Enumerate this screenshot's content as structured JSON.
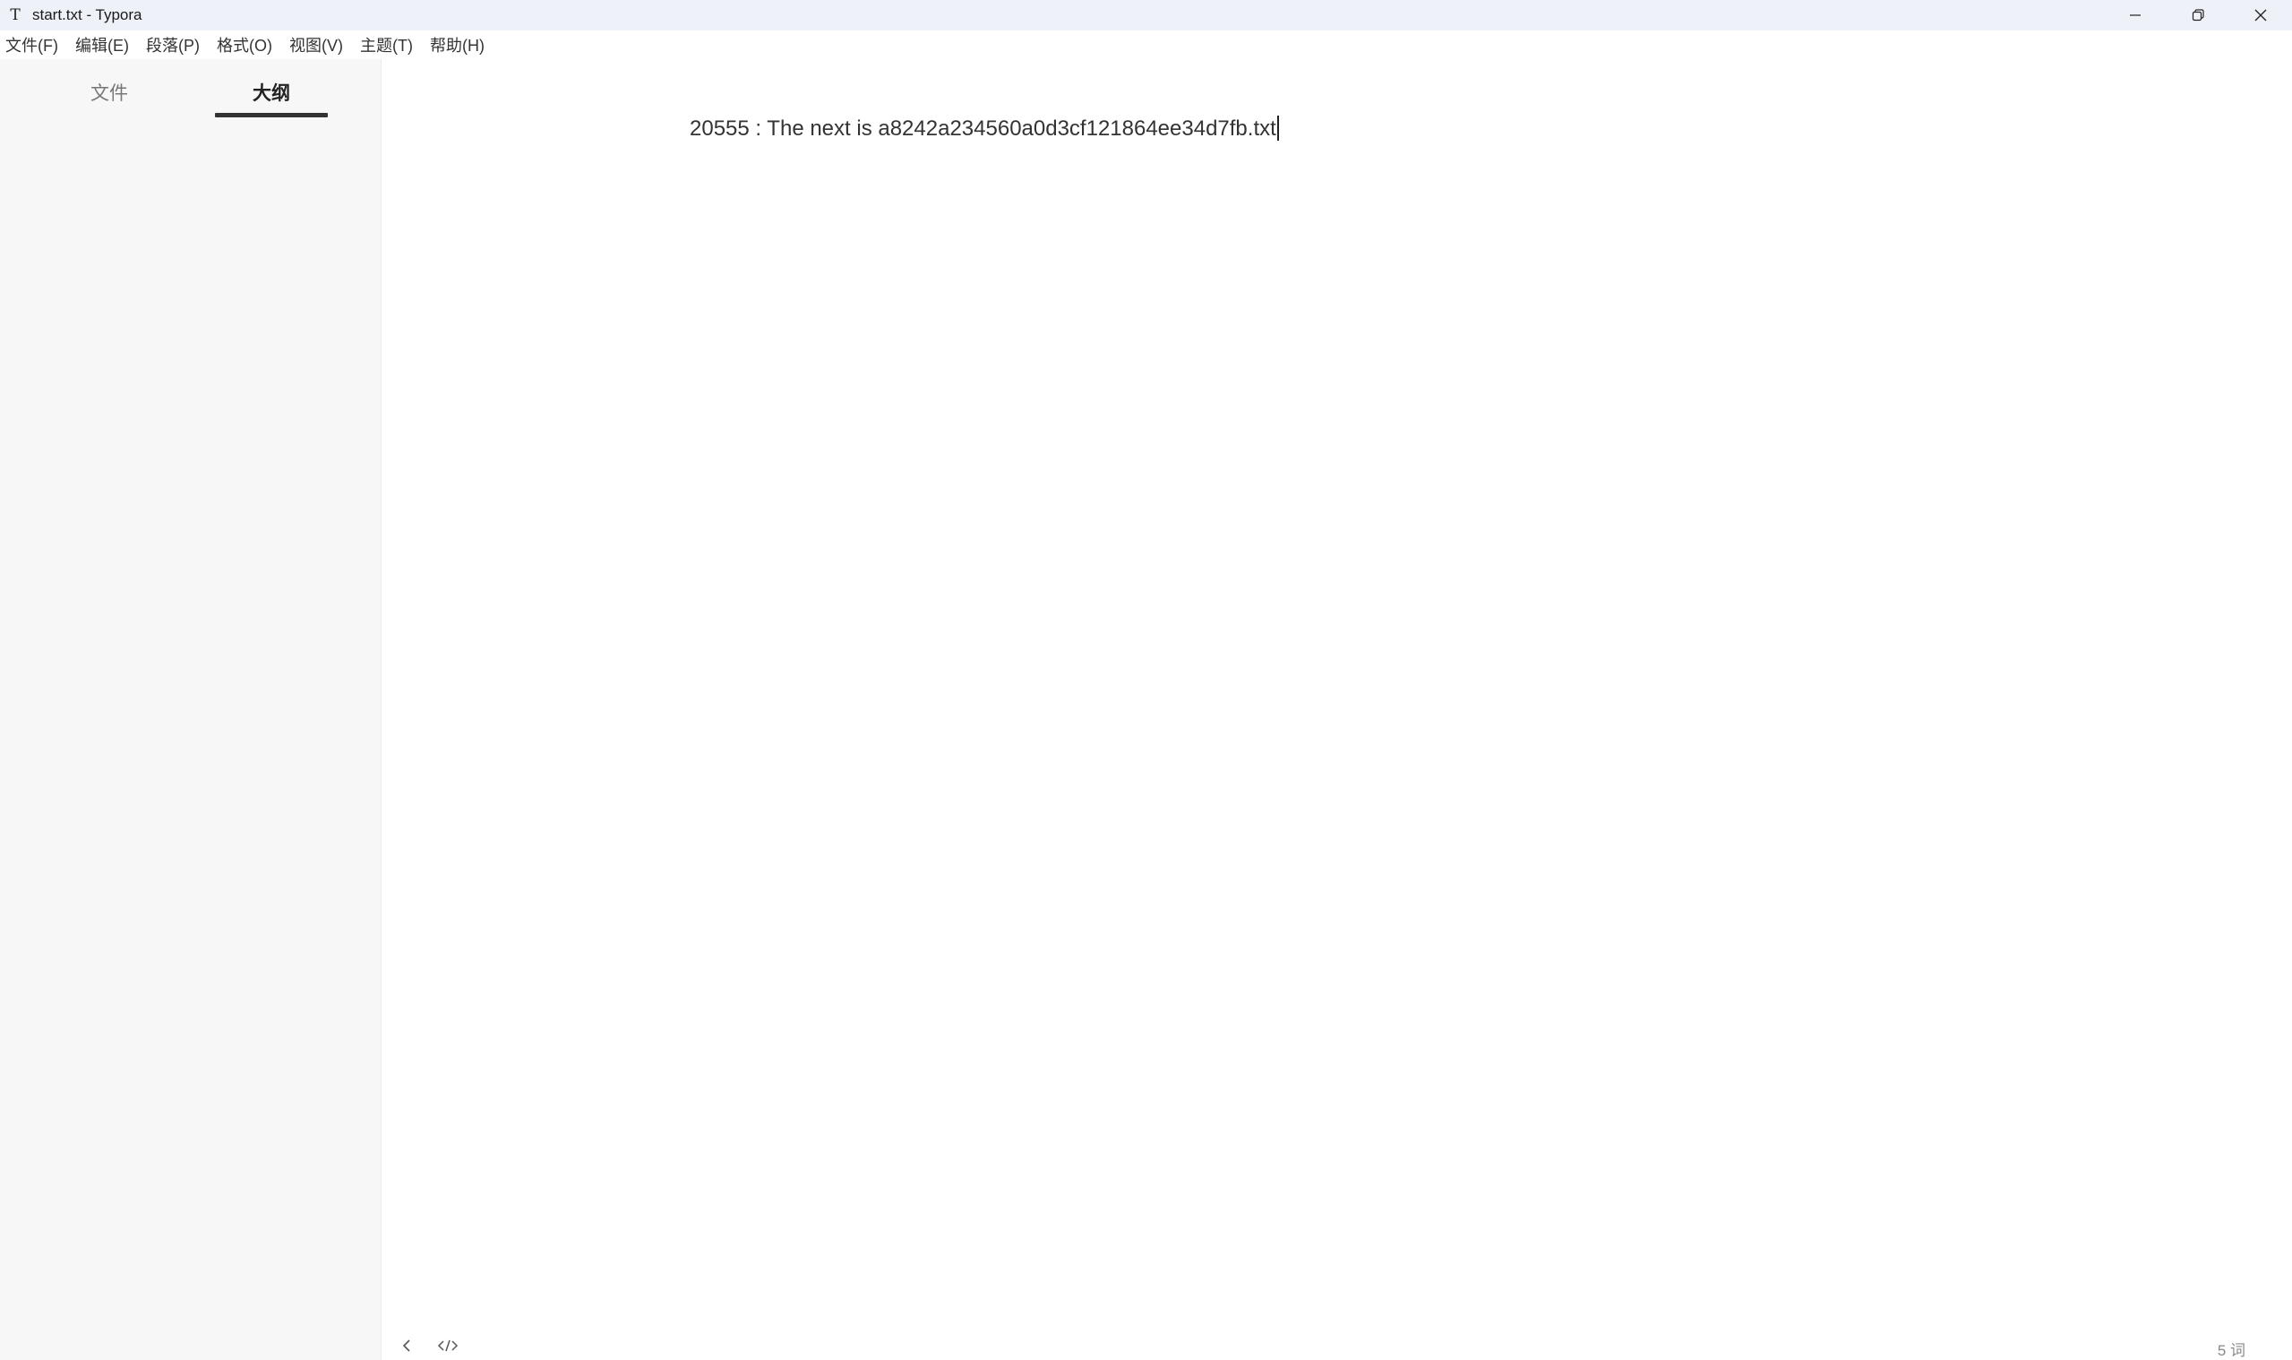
{
  "window": {
    "app_icon_glyph": "T",
    "title": "start.txt - Typora",
    "controls": [
      "minimize-icon",
      "restore-icon",
      "close-icon"
    ]
  },
  "menu": [
    "文件(F)",
    "编辑(E)",
    "段落(P)",
    "格式(O)",
    "视图(V)",
    "主题(T)",
    "帮助(H)"
  ],
  "sidebar": {
    "tabs": [
      {
        "label": "文件",
        "active": false
      },
      {
        "label": "大纲",
        "active": true
      }
    ]
  },
  "editor": {
    "content": "20555 : The next is a8242a234560a0d3cf121864ee34d7fb.txt"
  },
  "footer": {
    "left_icons": [
      "chevron-left-icon",
      "source-code-icon"
    ],
    "word_count": "5 词"
  }
}
